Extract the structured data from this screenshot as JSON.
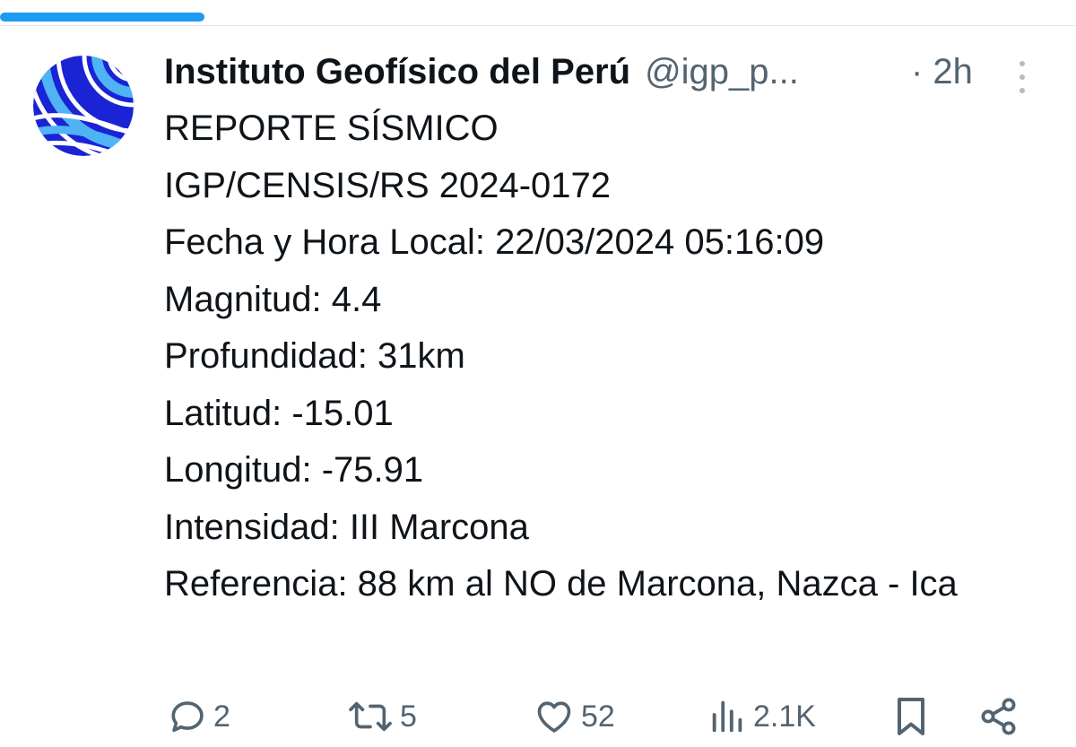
{
  "theme": {
    "accent": "#1d9bf0",
    "text_primary": "#0f1419",
    "text_secondary": "#536471",
    "avatar_blue": "#1a24d4"
  },
  "post": {
    "author_name": "Instituto Geofísico del Perú",
    "author_handle": "@igp_p...",
    "time": "· 2h",
    "avatar_icon": "igp-logo-icon",
    "body_lines": [
      "REPORTE SÍSMICO",
      "IGP/CENSIS/RS 2024-0172",
      "Fecha y Hora Local: 22/03/2024 05:16:09",
      "Magnitud: 4.4",
      "Profundidad: 31km",
      "Latitud: -15.01",
      "Longitud: -75.91",
      "Intensidad: III Marcona",
      "Referencia: 88 km al NO de Marcona, Nazca - Ica"
    ]
  },
  "actions": {
    "replies": {
      "icon": "reply-icon",
      "count": "2"
    },
    "reposts": {
      "icon": "repost-icon",
      "count": "5"
    },
    "likes": {
      "icon": "heart-icon",
      "count": "52"
    },
    "views": {
      "icon": "views-icon",
      "count": "2.1K"
    },
    "bookmark": {
      "icon": "bookmark-icon"
    },
    "share": {
      "icon": "share-icon"
    }
  }
}
